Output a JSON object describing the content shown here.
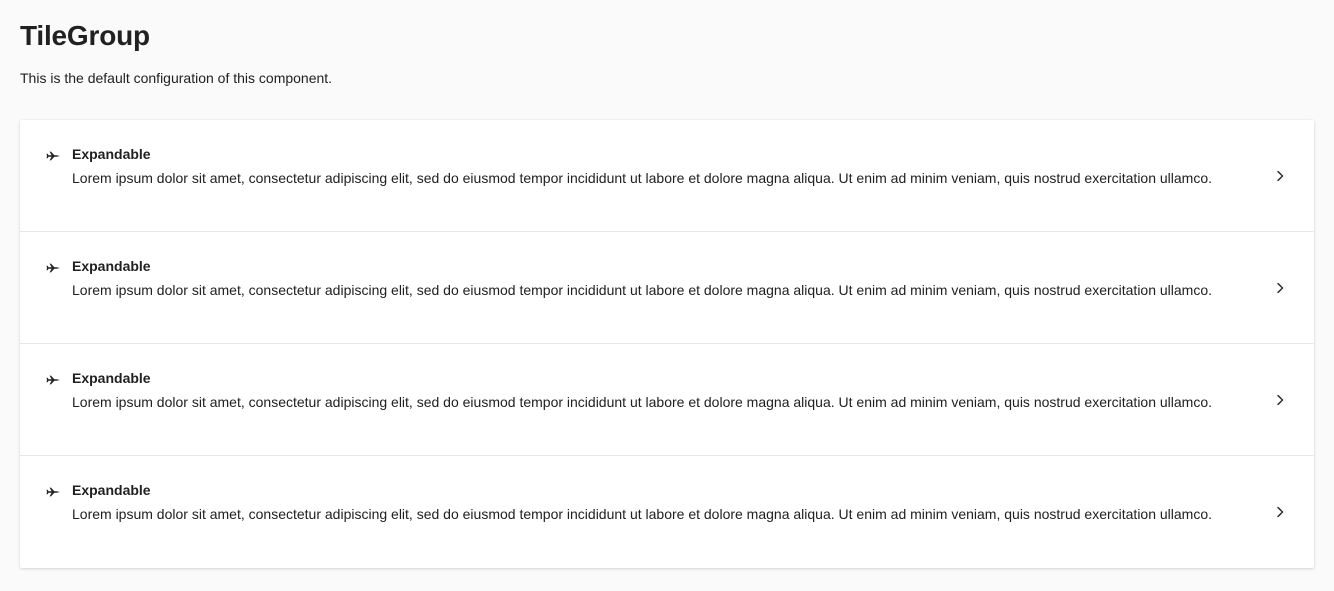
{
  "page": {
    "title": "TileGroup",
    "description": "This is the default configuration of this component."
  },
  "tiles": [
    {
      "icon": "airplane-icon",
      "title": "Expandable",
      "text": "Lorem ipsum dolor sit amet, consectetur adipiscing elit, sed do eiusmod tempor incididunt ut labore et dolore magna aliqua. Ut enim ad minim veniam, quis nostrud exercitation ullamco."
    },
    {
      "icon": "airplane-icon",
      "title": "Expandable",
      "text": "Lorem ipsum dolor sit amet, consectetur adipiscing elit, sed do eiusmod tempor incididunt ut labore et dolore magna aliqua. Ut enim ad minim veniam, quis nostrud exercitation ullamco."
    },
    {
      "icon": "airplane-icon",
      "title": "Expandable",
      "text": "Lorem ipsum dolor sit amet, consectetur adipiscing elit, sed do eiusmod tempor incididunt ut labore et dolore magna aliqua. Ut enim ad minim veniam, quis nostrud exercitation ullamco."
    },
    {
      "icon": "airplane-icon",
      "title": "Expandable",
      "text": "Lorem ipsum dolor sit amet, consectetur adipiscing elit, sed do eiusmod tempor incididunt ut labore et dolore magna aliqua. Ut enim ad minim veniam, quis nostrud exercitation ullamco."
    }
  ],
  "colors": {
    "background": "#fafafa",
    "surface": "#ffffff",
    "text": "#212121",
    "divider": "#e6e6e6"
  }
}
